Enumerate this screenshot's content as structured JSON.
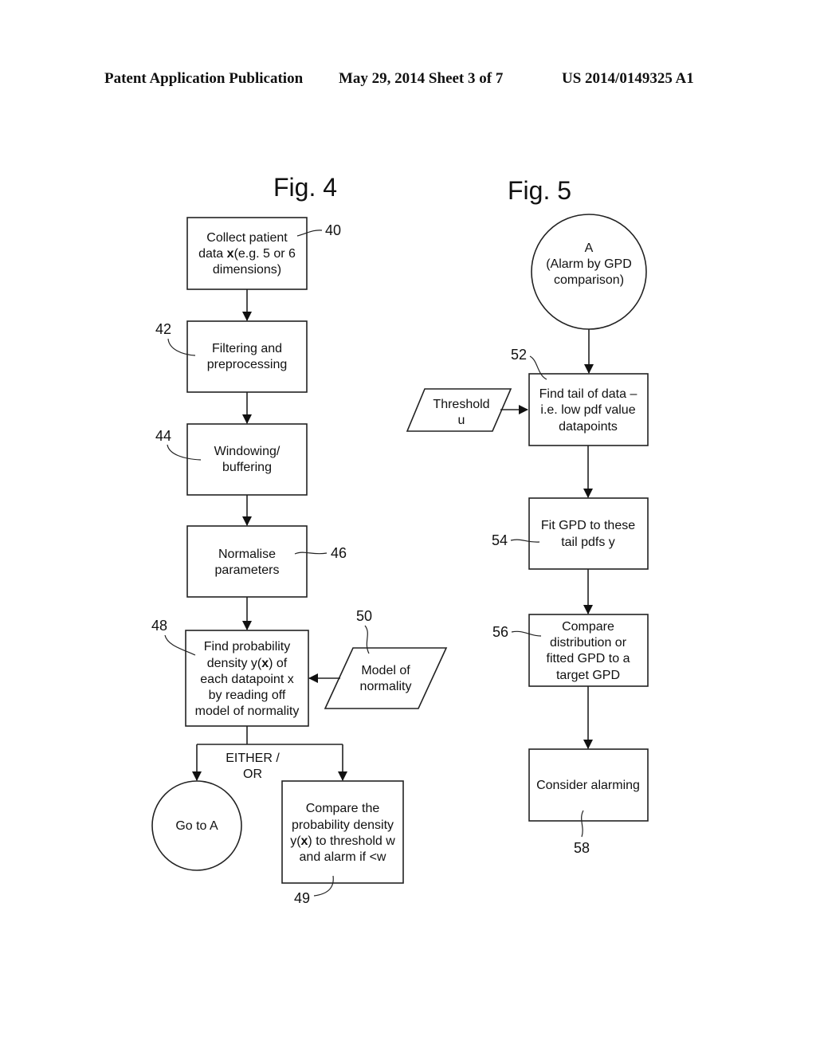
{
  "header": {
    "left": "Patent Application Publication",
    "middle": "May 29, 2014   Sheet 3 of 7",
    "right": "US 2014/0149325 A1"
  },
  "fig4": {
    "title": "Fig. 4",
    "collect": {
      "ref": "40",
      "line1": "Collect patient",
      "line2_pre": "data ",
      "line2_bold": "x",
      "line2_post": "(e.g. 5 or 6",
      "line3": "dimensions)"
    },
    "filtering": {
      "ref": "42",
      "line1": "Filtering and",
      "line2": "preprocessing"
    },
    "windowing": {
      "ref": "44",
      "line1": "Windowing/",
      "line2": "buffering"
    },
    "normalise": {
      "ref": "46",
      "line1": "Normalise",
      "line2": "parameters"
    },
    "find_density": {
      "ref": "48",
      "line1": "Find probability",
      "line2_pre": "density y(",
      "line2_bold": "x",
      "line2_post": ") of",
      "line3": "each datapoint x",
      "line4": "by reading off",
      "line5": "model of normality"
    },
    "model": {
      "ref": "50",
      "line1": "Model of",
      "line2": "normality"
    },
    "branch_label": {
      "line1": "EITHER /",
      "line2": "OR"
    },
    "goto": {
      "label": "Go to A"
    },
    "compare": {
      "ref": "49",
      "line1": "Compare the",
      "line2": "probability density",
      "line3_pre": "y(",
      "line3_bold": "x",
      "line3_post": ") to threshold w",
      "line4": "and alarm if <w"
    }
  },
  "fig5": {
    "title": "Fig. 5",
    "start": {
      "line1": "A",
      "line2": "(Alarm by GPD",
      "line3": "comparison)"
    },
    "threshold": {
      "line1": "Threshold",
      "line2": "u"
    },
    "find_tail": {
      "ref": "52",
      "line1": "Find tail of data –",
      "line2": "i.e. low pdf value",
      "line3": "datapoints"
    },
    "fit": {
      "ref": "54",
      "line1": "Fit GPD to these",
      "line2": "tail pdfs y"
    },
    "compare": {
      "ref": "56",
      "line1": "Compare",
      "line2": "distribution or",
      "line3": "fitted GPD to a",
      "line4": "target GPD"
    },
    "alarm": {
      "ref": "58",
      "line1": "Consider alarming"
    }
  }
}
